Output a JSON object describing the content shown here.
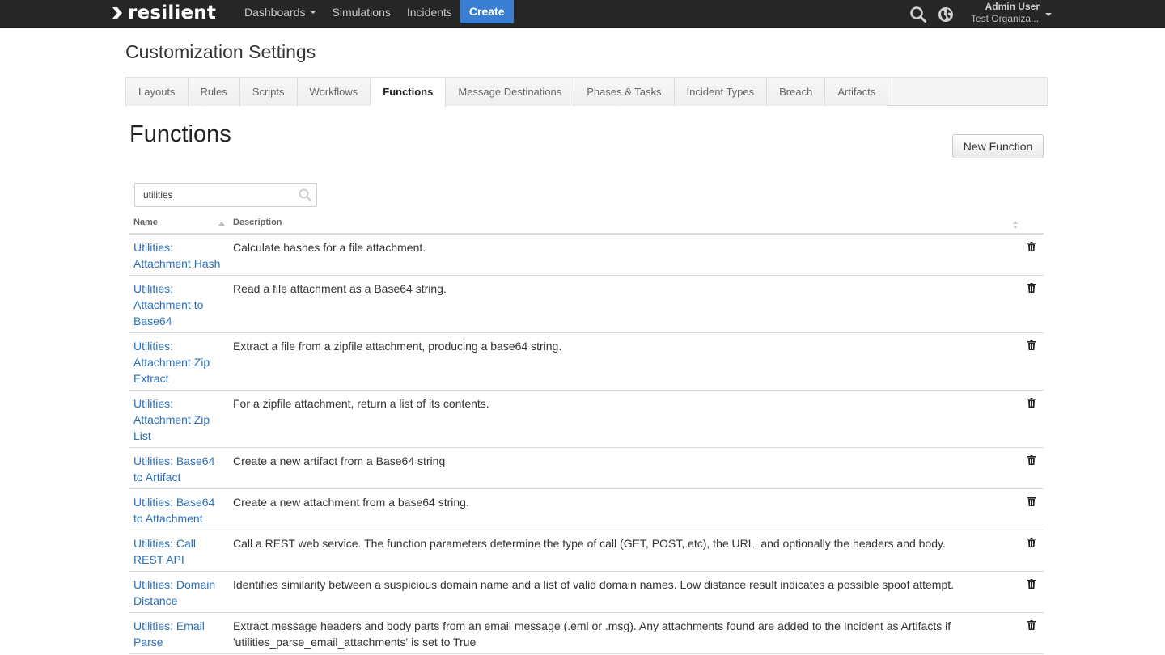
{
  "app": {
    "brand": "resilient"
  },
  "nav": {
    "items": [
      {
        "label": "Dashboards",
        "dropdown": true
      },
      {
        "label": "Simulations",
        "dropdown": false
      },
      {
        "label": "Incidents",
        "dropdown": false
      }
    ],
    "create_label": "Create",
    "search_icon": "search-icon",
    "globe_icon": "globe-icon"
  },
  "user": {
    "name": "Admin User",
    "org": "Test Organiza..."
  },
  "page": {
    "title": "Customization Settings"
  },
  "tabs": [
    {
      "label": "Layouts",
      "active": false
    },
    {
      "label": "Rules",
      "active": false
    },
    {
      "label": "Scripts",
      "active": false
    },
    {
      "label": "Workflows",
      "active": false
    },
    {
      "label": "Functions",
      "active": true
    },
    {
      "label": "Message Destinations",
      "active": false
    },
    {
      "label": "Phases & Tasks",
      "active": false
    },
    {
      "label": "Incident Types",
      "active": false
    },
    {
      "label": "Breach",
      "active": false
    },
    {
      "label": "Artifacts",
      "active": false
    }
  ],
  "section": {
    "title": "Functions",
    "new_button_label": "New Function"
  },
  "search": {
    "value": "utilities",
    "placeholder": ""
  },
  "table": {
    "columns": [
      "Name",
      "Description"
    ],
    "rows": [
      {
        "name": "Utilities: Attachment Hash",
        "description": "Calculate hashes for a file attachment."
      },
      {
        "name": "Utilities: Attachment to Base64",
        "description": "Read a file attachment as a Base64 string."
      },
      {
        "name": "Utilities: Attachment Zip Extract",
        "description": "Extract a file from a zipfile attachment, producing a base64 string."
      },
      {
        "name": "Utilities: Attachment Zip List",
        "description": "For a zipfile attachment, return a list of its contents."
      },
      {
        "name": "Utilities: Base64 to Artifact",
        "description": "Create a new artifact from a Base64 string"
      },
      {
        "name": "Utilities: Base64 to Attachment",
        "description": "Create a new attachment from a base64 string."
      },
      {
        "name": "Utilities: Call REST API",
        "description": "Call a REST web service. The function parameters determine the type of call (GET, POST, etc), the URL, and optionally the headers and body."
      },
      {
        "name": "Utilities: Domain Distance",
        "description": "Identifies similarity between a suspicious domain name and a list of valid domain names. Low distance result indicates a possible spoof attempt."
      },
      {
        "name": "Utilities: Email Parse",
        "description": "Extract message headers and body parts from an email message (.eml or .msg). Any attachments found are added to the Incident as Artifacts if 'utilities_parse_email_attachments' is set to True"
      }
    ]
  },
  "colors": {
    "topbar": "#262626",
    "accent": "#3a7ed4",
    "link": "#2a6fb7"
  }
}
